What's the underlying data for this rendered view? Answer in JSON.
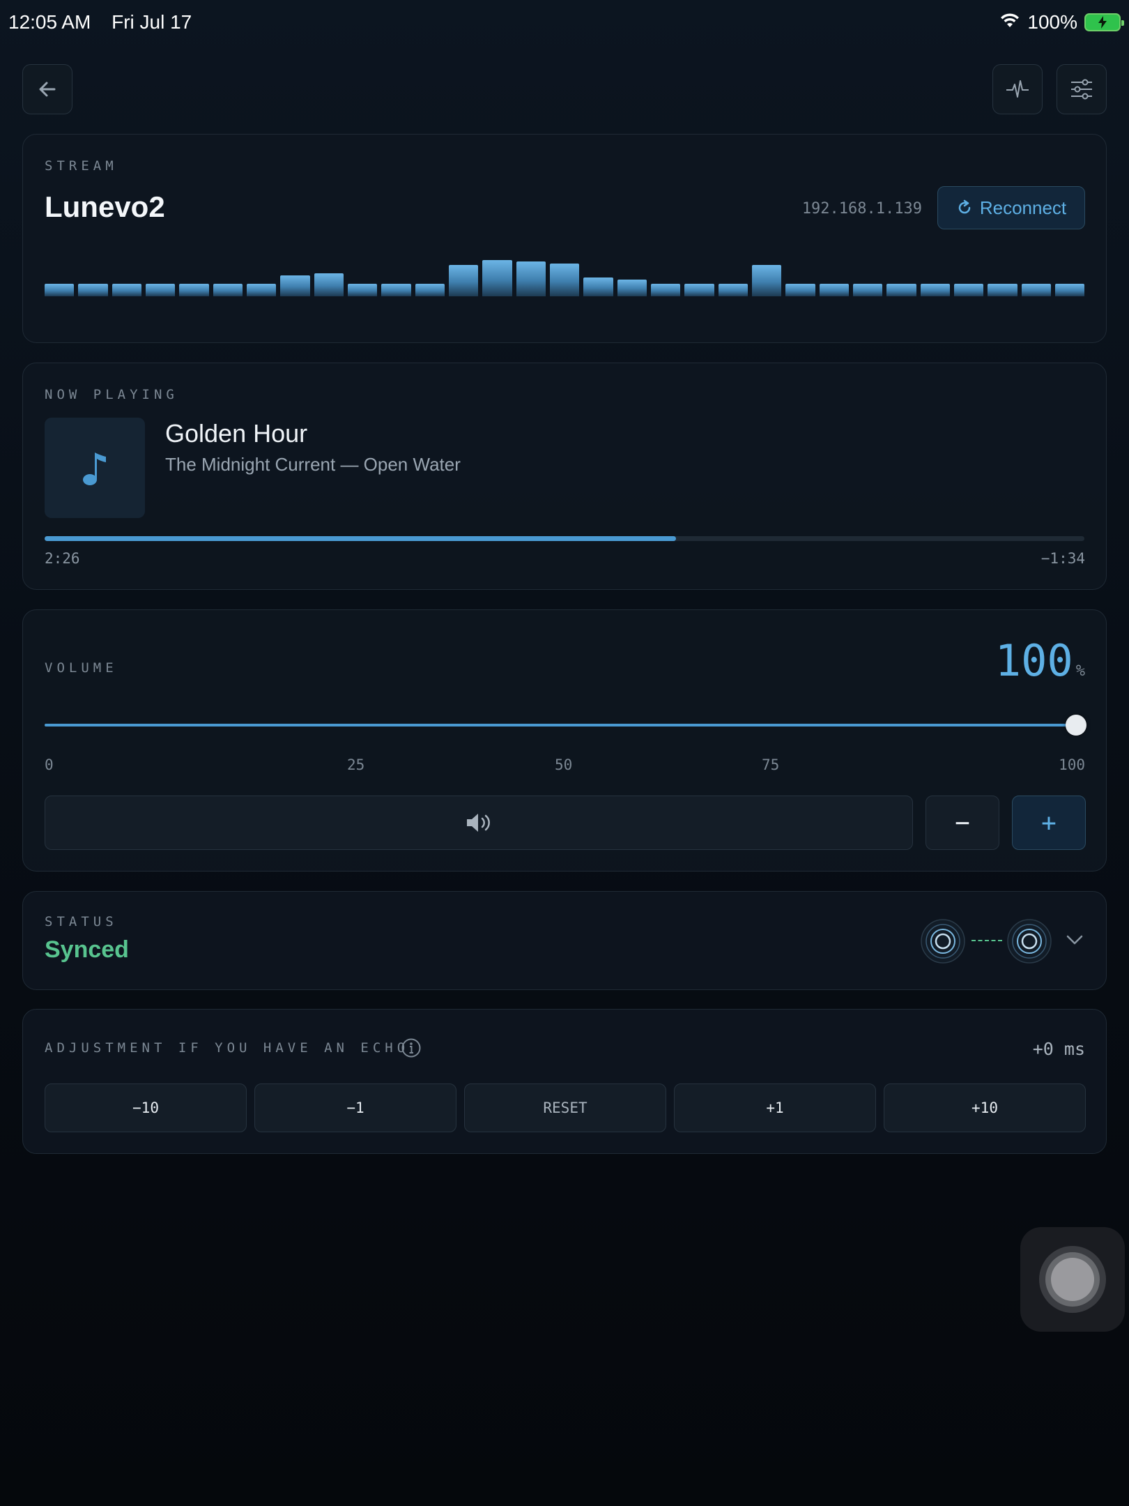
{
  "status_bar": {
    "time": "12:05 AM",
    "date": "Fri Jul 17",
    "battery": "100%"
  },
  "toolbar": {
    "back_icon": "arrow-left-icon",
    "activity_icon": "pulse-icon",
    "settings_icon": "sliders-icon"
  },
  "stream": {
    "label": "STREAM",
    "name": "Lunevo2",
    "ip": "192.168.1.139",
    "reconnect_label": "Reconnect",
    "levels": [
      0.25,
      0.25,
      0.25,
      0.25,
      0.25,
      0.25,
      0.25,
      0.42,
      0.46,
      0.25,
      0.25,
      0.25,
      0.62,
      0.72,
      0.69,
      0.65,
      0.38,
      0.34,
      0.25,
      0.25,
      0.25,
      0.62,
      0.25,
      0.25,
      0.25,
      0.25,
      0.25,
      0.25,
      0.25,
      0.25,
      0.25
    ]
  },
  "now_playing": {
    "label": "NOW PLAYING",
    "title": "Golden Hour",
    "subtitle": "The Midnight Current — Open Water",
    "elapsed": "2:26",
    "remaining": "−1:34",
    "progress": 0.607
  },
  "volume": {
    "label": "VOLUME",
    "value": "100",
    "unit": "%",
    "level": 1.0,
    "ticks": [
      "0",
      "25",
      "50",
      "75",
      "100"
    ],
    "decrease_label": "−",
    "increase_label": "+"
  },
  "status": {
    "label": "STATUS",
    "value": "Synced"
  },
  "echo": {
    "label": "ADJUSTMENT IF YOU HAVE AN ECHO",
    "value": "+0 ms",
    "buttons": [
      "−10",
      "−1",
      "RESET",
      "+1",
      "+10"
    ]
  },
  "colors": {
    "accent": "#5eb0e5",
    "synced": "#58c48f",
    "background": "#080e16"
  }
}
